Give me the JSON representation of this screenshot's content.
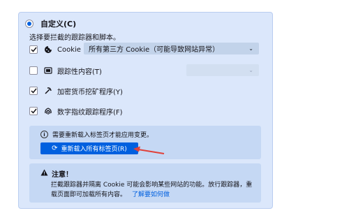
{
  "option": {
    "title": "自定义(C)",
    "subtitle": "选择要拦截的跟踪器和脚本。"
  },
  "rows": [
    {
      "label": "Cookie",
      "checked": true,
      "icon": "cookie-icon"
    },
    {
      "label": "跟踪性内容(T)",
      "checked": false,
      "icon": "tracking-content-icon"
    },
    {
      "label": "加密货币挖矿程序(Y)",
      "checked": true,
      "icon": "cryptominer-icon"
    },
    {
      "label": "数字指纹跟踪程序(F)",
      "checked": true,
      "icon": "fingerprinter-icon"
    }
  ],
  "cookie_select": {
    "value": "所有第三方 Cookie（可能导致网站异常）"
  },
  "tracking_select": {
    "value": ""
  },
  "notice": {
    "text": "需要重新载入标签页才能应用变更。",
    "button": "重新载入所有标签页(R)"
  },
  "warning": {
    "title": "注意！",
    "body": "拦截跟踪器并隔离 Cookie 可能会影响某些网站的功能。放行跟踪器，重载页面即可加载所有内容。",
    "link": "了解要如何做"
  },
  "colors": {
    "accent": "#0060df",
    "panel_bg": "#dbe7fb",
    "annotation_arrow": "#e0413a"
  }
}
